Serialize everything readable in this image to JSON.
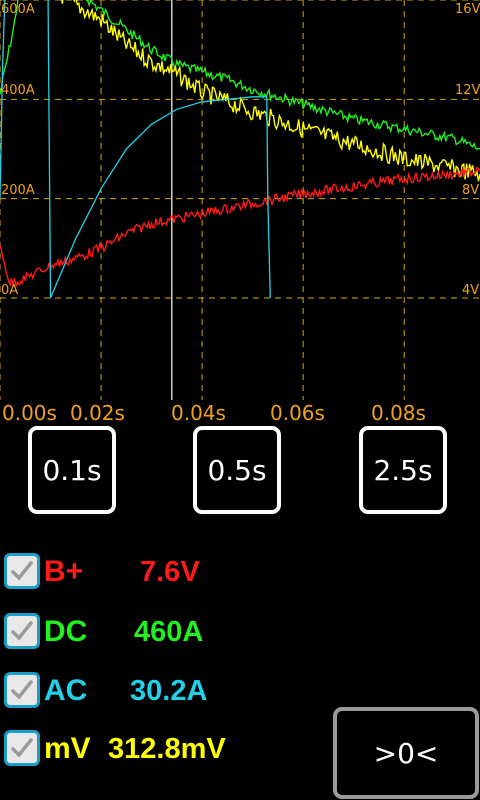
{
  "colors": {
    "grid": "#d8a800",
    "axis_text": "#f0a020",
    "batt": "#ff1a1a",
    "dc": "#22ee22",
    "ac": "#22d0e8",
    "mv": "#ffff00",
    "cursor": "#cccccc"
  },
  "scope": {
    "y_left_labels": [
      "600A",
      "400A",
      "200A",
      "0A"
    ],
    "y_right_labels": [
      "16V",
      "12V",
      "8V",
      "4V"
    ],
    "x_labels": [
      "0.00s",
      "0.02s",
      "0.04s",
      "0.06s",
      "0.08s"
    ]
  },
  "chart_data": {
    "type": "line",
    "xlim": [
      0.0,
      0.095
    ],
    "ylim_left_A": [
      0,
      600
    ],
    "ylim_right_V": [
      4,
      16
    ],
    "series": [
      {
        "name": "B+",
        "axis": "V",
        "x": [
          0.0,
          0.002,
          0.005,
          0.01,
          0.015,
          0.02,
          0.025,
          0.03,
          0.035,
          0.04,
          0.05,
          0.06,
          0.07,
          0.08,
          0.095
        ],
        "values": [
          6.0,
          4.6,
          4.8,
          5.3,
          5.6,
          6.0,
          6.6,
          7.0,
          7.2,
          7.4,
          7.8,
          8.2,
          8.5,
          8.8,
          9.1
        ]
      },
      {
        "name": "DC",
        "axis": "A",
        "x": [
          0.0,
          0.003,
          0.005,
          0.01,
          0.015,
          0.02,
          0.025,
          0.03,
          0.035,
          0.04,
          0.045,
          0.05,
          0.06,
          0.07,
          0.08,
          0.09,
          0.095
        ],
        "values": [
          410,
          560,
          720,
          660,
          620,
          580,
          540,
          500,
          470,
          455,
          440,
          420,
          390,
          360,
          340,
          320,
          300
        ]
      },
      {
        "name": "AC",
        "axis": "A",
        "x": [
          0.0,
          0.0005,
          0.001,
          0.009,
          0.0095,
          0.01,
          0.015,
          0.02,
          0.025,
          0.03,
          0.035,
          0.04,
          0.045,
          0.05,
          0.0528,
          0.053,
          0.0535
        ],
        "values": [
          200,
          460,
          620,
          700,
          620,
          0,
          120,
          220,
          300,
          350,
          380,
          395,
          400,
          405,
          405,
          200,
          0
        ]
      },
      {
        "name": "mV",
        "axis": "V",
        "x": [
          0.0,
          0.002,
          0.005,
          0.01,
          0.015,
          0.02,
          0.025,
          0.03,
          0.035,
          0.04,
          0.05,
          0.06,
          0.07,
          0.08,
          0.095
        ],
        "values": [
          22,
          20,
          17.5,
          16.5,
          15.8,
          15.2,
          14.2,
          13.5,
          13.0,
          12.3,
          11.5,
          10.8,
          10.2,
          9.6,
          9.0
        ]
      }
    ]
  },
  "timebase_buttons": [
    "0.1s",
    "0.5s",
    "2.5s"
  ],
  "channels": [
    {
      "name": "B+",
      "value": "7.6V",
      "checked": true
    },
    {
      "name": "DC",
      "value": "460A",
      "checked": true
    },
    {
      "name": "AC",
      "value": "30.2A",
      "checked": true
    },
    {
      "name": "mV",
      "value": "312.8mV",
      "checked": true
    }
  ],
  "zero_button": ">0<"
}
